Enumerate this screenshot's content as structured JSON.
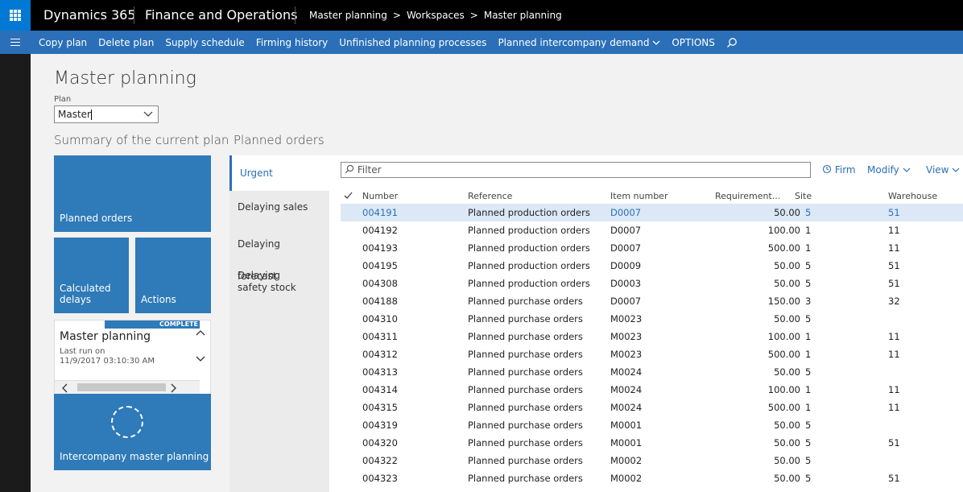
{
  "topbar": {
    "app_name": "Dynamics 365",
    "module": "Finance and Operations",
    "breadcrumb": [
      "Master planning",
      "Workspaces",
      "Master planning"
    ],
    "breadcrumb_separator": ">"
  },
  "actionbar": {
    "items": [
      "Copy plan",
      "Delete plan",
      "Supply schedule",
      "Firming history",
      "Unfinished planning processes",
      "Planned intercompany demand",
      "OPTIONS"
    ],
    "dropdown_item_index": 5,
    "search_icon": "search-icon"
  },
  "page": {
    "title": "Master planning",
    "plan_label": "Plan",
    "plan_value": "Master",
    "summary_title": "Summary of the current plan",
    "planned_orders_title": "Planned orders"
  },
  "tiles": {
    "planned_orders": "Planned orders",
    "calculated_delays": "Calculated delays",
    "actions": "Actions",
    "intercompany": "Intercompany master planning"
  },
  "status_card": {
    "badge": "COMPLETE",
    "title": "Master planning",
    "last_run_label": "Last run on",
    "last_run_value": "11/9/2017 03:10:30 AM"
  },
  "tabs": [
    "Urgent",
    "Delaying sales",
    "Delaying forecast",
    "Delaying safety stock"
  ],
  "active_tab_index": 0,
  "grid": {
    "filter_placeholder": "Filter",
    "firm_label": "Firm",
    "modify_label": "Modify",
    "view_label": "View",
    "columns": [
      "Number",
      "Reference",
      "Item number",
      "Requirement...",
      "Site",
      "Warehouse"
    ],
    "selected_row_index": 0,
    "rows": [
      [
        "004191",
        "Planned production orders",
        "D0007",
        "50.00",
        "5",
        "51"
      ],
      [
        "004192",
        "Planned production orders",
        "D0007",
        "100.00",
        "1",
        "11"
      ],
      [
        "004193",
        "Planned production orders",
        "D0007",
        "500.00",
        "1",
        "11"
      ],
      [
        "004195",
        "Planned production orders",
        "D0009",
        "50.00",
        "5",
        "51"
      ],
      [
        "004308",
        "Planned production orders",
        "D0003",
        "50.00",
        "5",
        "51"
      ],
      [
        "004188",
        "Planned purchase orders",
        "D0007",
        "150.00",
        "3",
        "32"
      ],
      [
        "004310",
        "Planned purchase orders",
        "M0023",
        "50.00",
        "5",
        ""
      ],
      [
        "004311",
        "Planned purchase orders",
        "M0023",
        "100.00",
        "1",
        "11"
      ],
      [
        "004312",
        "Planned purchase orders",
        "M0023",
        "500.00",
        "1",
        "11"
      ],
      [
        "004313",
        "Planned purchase orders",
        "M0024",
        "50.00",
        "5",
        ""
      ],
      [
        "004314",
        "Planned purchase orders",
        "M0024",
        "100.00",
        "1",
        "11"
      ],
      [
        "004315",
        "Planned purchase orders",
        "M0024",
        "500.00",
        "1",
        "11"
      ],
      [
        "004319",
        "Planned purchase orders",
        "M0001",
        "50.00",
        "5",
        ""
      ],
      [
        "004320",
        "Planned purchase orders",
        "M0001",
        "50.00",
        "5",
        "51"
      ],
      [
        "004322",
        "Planned purchase orders",
        "M0002",
        "50.00",
        "5",
        ""
      ],
      [
        "004323",
        "Planned purchase orders",
        "M0002",
        "50.00",
        "5",
        "51"
      ]
    ]
  },
  "colors": {
    "accent": "#2a6fb8",
    "tile": "#2f7ab8",
    "selected_row": "#dce8f5"
  }
}
